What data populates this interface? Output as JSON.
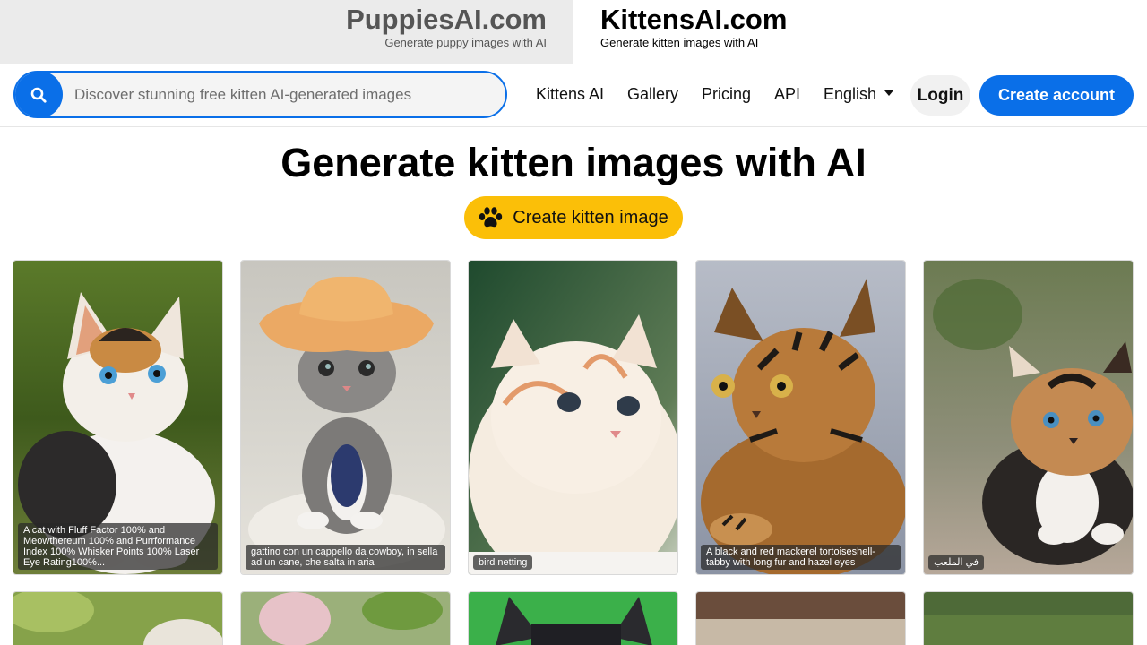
{
  "sites": {
    "other": {
      "title": "PuppiesAI.com",
      "subtitle": "Generate puppy images with AI"
    },
    "current": {
      "title": "KittensAI.com",
      "subtitle": "Generate kitten images with AI"
    }
  },
  "search": {
    "placeholder": "Discover stunning free kitten AI-generated images",
    "value": ""
  },
  "nav": {
    "kittens_ai": "Kittens AI",
    "gallery": "Gallery",
    "pricing": "Pricing",
    "api": "API",
    "language": "English",
    "login": "Login",
    "create_account": "Create account"
  },
  "hero": {
    "title": "Generate kitten images with AI",
    "cta_label": "Create kitten image",
    "cta_icon": "paw-icon"
  },
  "gallery": {
    "cards": [
      {
        "caption": "A cat with Fluff Factor 100% and Meowthereum 100% and Purrformance Index 100% Whisker Points 100% Laser Eye Rating100%..."
      },
      {
        "caption": "gattino con un cappello da cowboy, in sella ad un cane, che salta in aria"
      },
      {
        "caption": "bird netting"
      },
      {
        "caption": "A black and red mackerel tortoiseshell-tabby with long fur and hazel eyes"
      },
      {
        "caption": "في الملعب"
      }
    ]
  },
  "colors": {
    "accent": "#0a6fe8",
    "cta": "#fbbf08",
    "switcher_inactive_bg": "#ebebeb"
  }
}
